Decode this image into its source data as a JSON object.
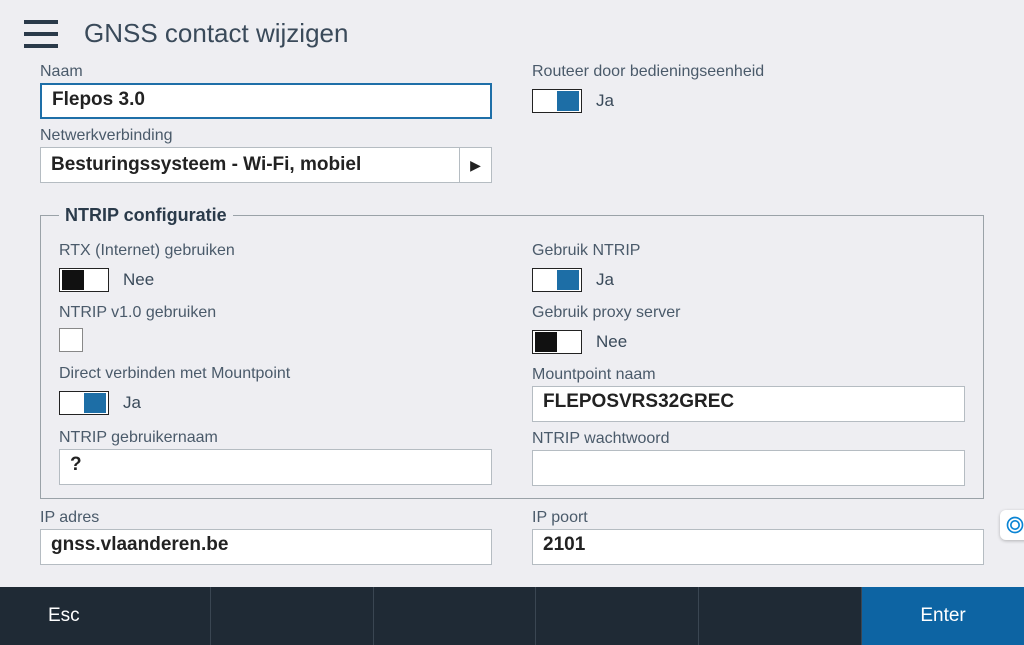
{
  "header": {
    "title": "GNSS contact wijzigen"
  },
  "labels": {
    "name": "Naam",
    "network": "Netwerkverbinding",
    "route": "Routeer door bedieningseenheid",
    "ntrip_legend": "NTRIP configuratie",
    "rtx": "RTX (Internet) gebruiken",
    "ntrip_v1": "NTRIP v1.0 gebruiken",
    "direct_mp": "Direct verbinden met Mountpoint",
    "ntrip_user": "NTRIP gebruikernaam",
    "use_ntrip": "Gebruik NTRIP",
    "proxy": "Gebruik proxy server",
    "mp_name": "Mountpoint naam",
    "ntrip_pass": "NTRIP wachtwoord",
    "ip_addr": "IP adres",
    "ip_port": "IP poort"
  },
  "values": {
    "name": "Flepos 3.0",
    "network": "Besturingssysteem - Wi-Fi, mobiel",
    "route_state": "Ja",
    "rtx_state": "Nee",
    "direct_mp_state": "Ja",
    "ntrip_user": "?",
    "use_ntrip_state": "Ja",
    "proxy_state": "Nee",
    "mp_name": "FLEPOSVRS32GREC",
    "ntrip_pass": "",
    "ip_addr": "gnss.vlaanderen.be",
    "ip_port": "2101"
  },
  "buttons": {
    "esc": "Esc",
    "enter": "Enter"
  }
}
